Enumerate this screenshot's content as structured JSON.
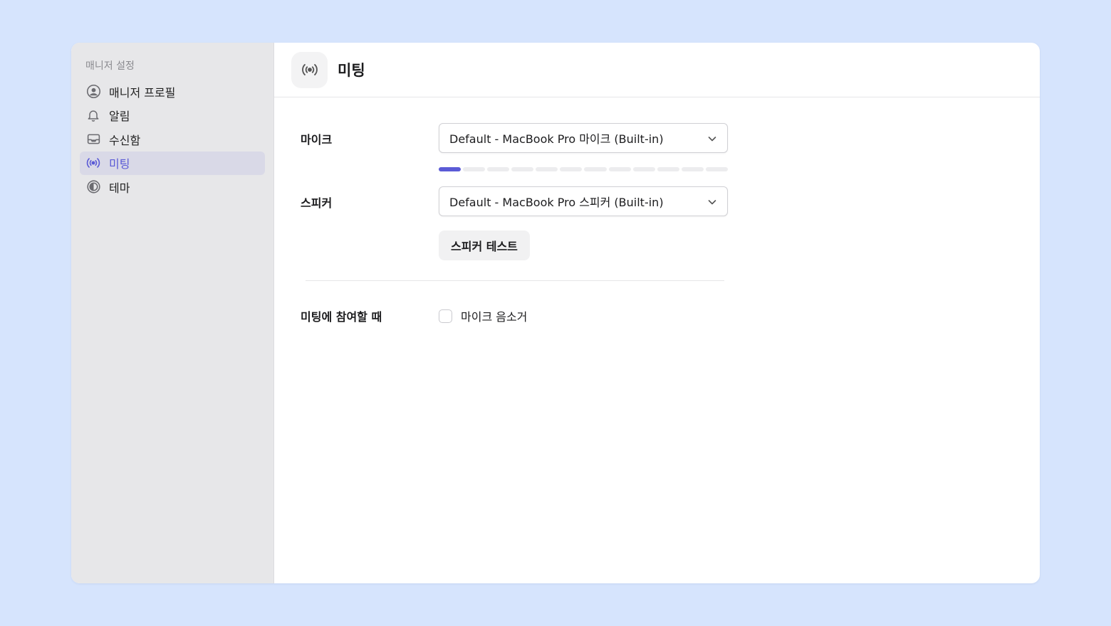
{
  "sidebar": {
    "heading": "매니저 설정",
    "items": [
      {
        "label": "매니저 프로필",
        "icon": "user-circle-icon"
      },
      {
        "label": "알림",
        "icon": "bell-icon"
      },
      {
        "label": "수신함",
        "icon": "inbox-icon"
      },
      {
        "label": "미팅",
        "icon": "broadcast-icon",
        "active": true
      },
      {
        "label": "테마",
        "icon": "contrast-icon"
      }
    ]
  },
  "header": {
    "title": "미팅",
    "icon": "broadcast-icon"
  },
  "mic": {
    "label": "마이크",
    "selected": "Default - MacBook Pro 마이크 (Built-in)",
    "level_segments_total": 12,
    "level_segments_active": 1
  },
  "speaker": {
    "label": "스피커",
    "selected": "Default - MacBook Pro 스피커 (Built-in)",
    "test_button": "스피커 테스트"
  },
  "join": {
    "label": "미팅에 참여할 때",
    "mute_mic_label": "마이크 음소거",
    "mute_mic_checked": false
  },
  "colors": {
    "accent": "#5b5bd6",
    "background": "#d6e4fd",
    "sidebar": "#e7e7e9"
  }
}
